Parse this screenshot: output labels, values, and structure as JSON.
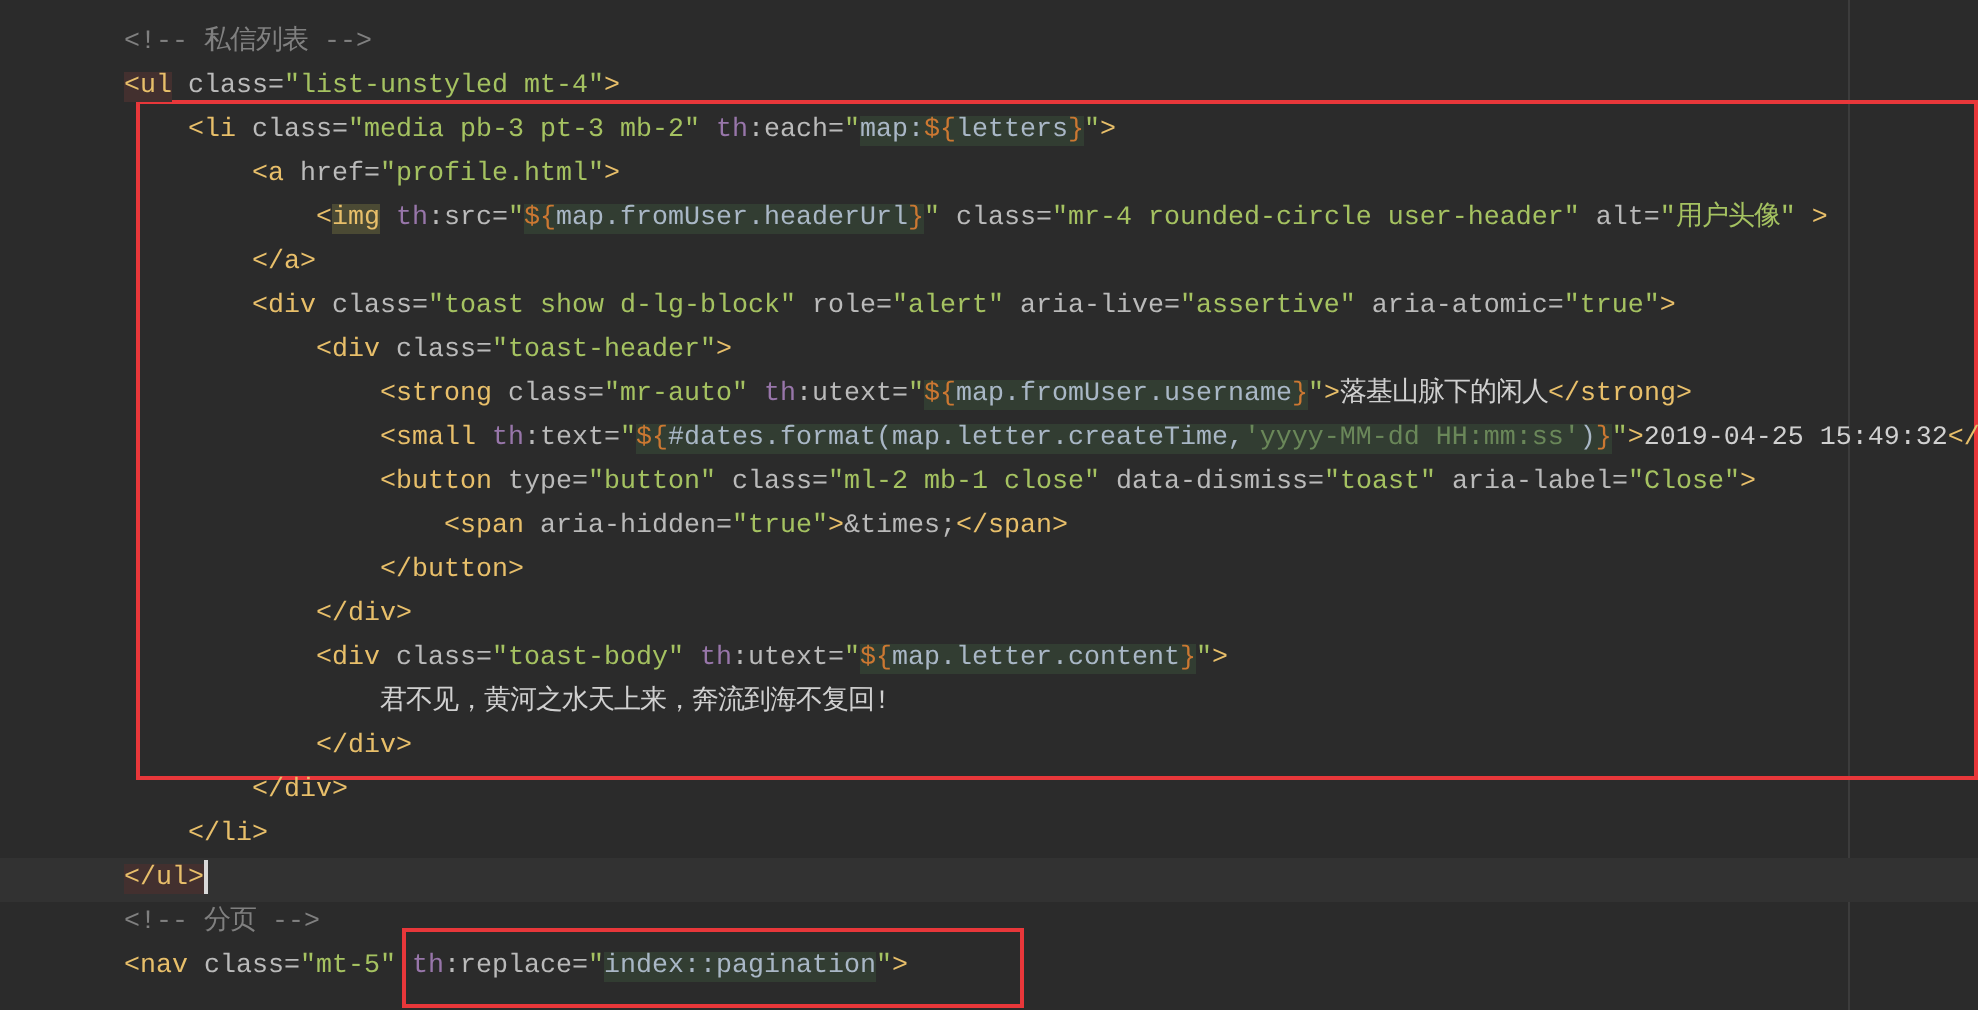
{
  "editor": {
    "lines": [
      {
        "framed": false,
        "current": false,
        "segments": [
          {
            "framed": false,
            "tokens": [
              {
                "kind": "comment",
                "text": "<!-- 私信列表 -->"
              }
            ]
          }
        ]
      },
      {
        "framed": false,
        "current": false,
        "segments": [
          {
            "framed": false,
            "tokens": [
              {
                "kind": "tag-match",
                "text": "<ul"
              },
              {
                "kind": "attr",
                "text": " class="
              },
              {
                "kind": "value",
                "text": "\"list-unstyled mt-4\""
              },
              {
                "kind": "tag",
                "text": ">"
              }
            ]
          }
        ],
        "children": [
          {
            "framed": true,
            "current": false,
            "segments": [
              {
                "framed": false,
                "tokens": [
                  {
                    "kind": "tag",
                    "text": "<li"
                  },
                  {
                    "kind": "attr",
                    "text": " class="
                  },
                  {
                    "kind": "value",
                    "text": "\"media pb-3 pt-3 mb-2\""
                  },
                  {
                    "kind": "ns",
                    "text": " th"
                  },
                  {
                    "kind": "attr",
                    "text": ":each="
                  },
                  {
                    "kind": "value",
                    "text": "\""
                  },
                  {
                    "kind": "expr",
                    "text": "map:"
                  },
                  {
                    "kind": "expr-delim",
                    "text": "${"
                  },
                  {
                    "kind": "expr",
                    "text": "letters"
                  },
                  {
                    "kind": "expr-delim",
                    "text": "}"
                  },
                  {
                    "kind": "value",
                    "text": "\""
                  },
                  {
                    "kind": "tag",
                    "text": ">"
                  }
                ]
              }
            ],
            "children": [
              {
                "framed": true,
                "current": false,
                "segments": [
                  {
                    "framed": false,
                    "tokens": [
                      {
                        "kind": "tag",
                        "text": "<a"
                      },
                      {
                        "kind": "attr",
                        "text": " href="
                      },
                      {
                        "kind": "value",
                        "text": "\"profile.html\""
                      },
                      {
                        "kind": "tag",
                        "text": ">"
                      }
                    ]
                  }
                ],
                "children": [
                  {
                    "framed": true,
                    "current": false,
                    "segments": [
                      {
                        "framed": false,
                        "tokens": [
                          {
                            "kind": "tag",
                            "text": "<"
                          },
                          {
                            "kind": "tag-hl",
                            "text": "img"
                          },
                          {
                            "kind": "ns",
                            "text": " th"
                          },
                          {
                            "kind": "attr",
                            "text": ":src="
                          },
                          {
                            "kind": "value",
                            "text": "\""
                          },
                          {
                            "kind": "expr-delim",
                            "text": "${"
                          },
                          {
                            "kind": "expr",
                            "text": "map.fromUser.headerUrl"
                          },
                          {
                            "kind": "expr-delim",
                            "text": "}"
                          },
                          {
                            "kind": "value",
                            "text": "\""
                          },
                          {
                            "kind": "attr",
                            "text": " class="
                          },
                          {
                            "kind": "value",
                            "text": "\"mr-4 rounded-circle user-header\""
                          },
                          {
                            "kind": "attr",
                            "text": " alt="
                          },
                          {
                            "kind": "value",
                            "text": "\"用户头像\""
                          },
                          {
                            "kind": "tag",
                            "text": " >"
                          }
                        ]
                      }
                    ]
                  }
                ]
              },
              {
                "framed": true,
                "current": false,
                "segments": [
                  {
                    "framed": false,
                    "tokens": [
                      {
                        "kind": "tag",
                        "text": "</a>"
                      }
                    ]
                  }
                ]
              },
              {
                "framed": true,
                "current": false,
                "segments": [
                  {
                    "framed": false,
                    "tokens": [
                      {
                        "kind": "tag",
                        "text": "<div"
                      },
                      {
                        "kind": "attr",
                        "text": " class="
                      },
                      {
                        "kind": "value",
                        "text": "\"toast show d-lg-block\""
                      },
                      {
                        "kind": "attr",
                        "text": " role="
                      },
                      {
                        "kind": "value",
                        "text": "\"alert\""
                      },
                      {
                        "kind": "attr",
                        "text": " aria-live="
                      },
                      {
                        "kind": "value",
                        "text": "\"assertive\""
                      },
                      {
                        "kind": "attr",
                        "text": " aria-atomic="
                      },
                      {
                        "kind": "value",
                        "text": "\"true\""
                      },
                      {
                        "kind": "tag",
                        "text": ">"
                      }
                    ]
                  }
                ],
                "children": [
                  {
                    "framed": true,
                    "current": false,
                    "segments": [
                      {
                        "framed": false,
                        "tokens": [
                          {
                            "kind": "tag",
                            "text": "<div"
                          },
                          {
                            "kind": "attr",
                            "text": " class="
                          },
                          {
                            "kind": "value",
                            "text": "\"toast-header\""
                          },
                          {
                            "kind": "tag",
                            "text": ">"
                          }
                        ]
                      }
                    ],
                    "children": [
                      {
                        "framed": true,
                        "current": false,
                        "segments": [
                          {
                            "framed": false,
                            "tokens": [
                              {
                                "kind": "tag",
                                "text": "<strong"
                              },
                              {
                                "kind": "attr",
                                "text": " class="
                              },
                              {
                                "kind": "value",
                                "text": "\"mr-auto\""
                              },
                              {
                                "kind": "ns",
                                "text": " th"
                              },
                              {
                                "kind": "attr",
                                "text": ":utext="
                              },
                              {
                                "kind": "value",
                                "text": "\""
                              },
                              {
                                "kind": "expr-delim",
                                "text": "${"
                              },
                              {
                                "kind": "expr",
                                "text": "map.fromUser.username"
                              },
                              {
                                "kind": "expr-delim",
                                "text": "}"
                              },
                              {
                                "kind": "value",
                                "text": "\""
                              },
                              {
                                "kind": "tag",
                                "text": ">"
                              },
                              {
                                "kind": "text",
                                "text": "落基山脉下的闲人"
                              },
                              {
                                "kind": "tag",
                                "text": "</strong>"
                              }
                            ]
                          }
                        ]
                      },
                      {
                        "framed": true,
                        "current": false,
                        "segments": [
                          {
                            "framed": false,
                            "tokens": [
                              {
                                "kind": "tag",
                                "text": "<small"
                              },
                              {
                                "kind": "ns",
                                "text": " th"
                              },
                              {
                                "kind": "attr",
                                "text": ":text="
                              },
                              {
                                "kind": "value",
                                "text": "\""
                              },
                              {
                                "kind": "expr-delim",
                                "text": "${"
                              },
                              {
                                "kind": "expr",
                                "text": "#dates.format(map.letter.createTime,"
                              },
                              {
                                "kind": "expr-str",
                                "text": "'yyyy-MM-dd HH:mm:ss'"
                              },
                              {
                                "kind": "expr",
                                "text": ")"
                              },
                              {
                                "kind": "expr-delim",
                                "text": "}"
                              },
                              {
                                "kind": "value",
                                "text": "\""
                              },
                              {
                                "kind": "tag",
                                "text": ">"
                              },
                              {
                                "kind": "text",
                                "text": "2019-04-25 15:49:32"
                              },
                              {
                                "kind": "tag",
                                "text": "</"
                              }
                            ]
                          }
                        ]
                      },
                      {
                        "framed": true,
                        "current": false,
                        "segments": [
                          {
                            "framed": false,
                            "tokens": [
                              {
                                "kind": "tag",
                                "text": "<button"
                              },
                              {
                                "kind": "attr",
                                "text": " type="
                              },
                              {
                                "kind": "value",
                                "text": "\"button\""
                              },
                              {
                                "kind": "attr",
                                "text": " class="
                              },
                              {
                                "kind": "value",
                                "text": "\"ml-2 mb-1 close\""
                              },
                              {
                                "kind": "attr",
                                "text": " data-dismiss="
                              },
                              {
                                "kind": "value",
                                "text": "\"toast\""
                              },
                              {
                                "kind": "attr",
                                "text": " aria-label="
                              },
                              {
                                "kind": "value",
                                "text": "\"Close\""
                              },
                              {
                                "kind": "tag",
                                "text": ">"
                              }
                            ]
                          }
                        ],
                        "children": [
                          {
                            "framed": true,
                            "current": false,
                            "segments": [
                              {
                                "framed": false,
                                "tokens": [
                                  {
                                    "kind": "tag",
                                    "text": "<span"
                                  },
                                  {
                                    "kind": "attr",
                                    "text": " aria-hidden="
                                  },
                                  {
                                    "kind": "value",
                                    "text": "\"true\""
                                  },
                                  {
                                    "kind": "tag",
                                    "text": ">"
                                  },
                                  {
                                    "kind": "attr",
                                    "text": "&times;"
                                  },
                                  {
                                    "kind": "tag",
                                    "text": "</span>"
                                  }
                                ]
                              }
                            ]
                          }
                        ]
                      },
                      {
                        "framed": true,
                        "current": false,
                        "segments": [
                          {
                            "framed": false,
                            "tokens": [
                              {
                                "kind": "tag",
                                "text": "</button>"
                              }
                            ]
                          }
                        ]
                      }
                    ]
                  },
                  {
                    "framed": true,
                    "current": false,
                    "segments": [
                      {
                        "framed": false,
                        "tokens": [
                          {
                            "kind": "tag",
                            "text": "</div>"
                          }
                        ]
                      }
                    ]
                  },
                  {
                    "framed": true,
                    "current": false,
                    "segments": [
                      {
                        "framed": false,
                        "tokens": [
                          {
                            "kind": "tag",
                            "text": "<div"
                          },
                          {
                            "kind": "attr",
                            "text": " class="
                          },
                          {
                            "kind": "value",
                            "text": "\"toast-body\""
                          },
                          {
                            "kind": "ns",
                            "text": " th"
                          },
                          {
                            "kind": "attr",
                            "text": ":utext="
                          },
                          {
                            "kind": "value",
                            "text": "\""
                          },
                          {
                            "kind": "expr-delim",
                            "text": "${"
                          },
                          {
                            "kind": "expr",
                            "text": "map.letter.content"
                          },
                          {
                            "kind": "expr-delim",
                            "text": "}"
                          },
                          {
                            "kind": "value",
                            "text": "\""
                          },
                          {
                            "kind": "tag",
                            "text": ">"
                          }
                        ]
                      }
                    ],
                    "children": [
                      {
                        "framed": true,
                        "current": false,
                        "segments": [
                          {
                            "framed": false,
                            "tokens": [
                              {
                                "kind": "text",
                                "text": "君不见，黄河之水天上来，奔流到海不复回!"
                              }
                            ]
                          }
                        ]
                      }
                    ]
                  },
                  {
                    "framed": true,
                    "current": false,
                    "segments": [
                      {
                        "framed": false,
                        "tokens": [
                          {
                            "kind": "tag",
                            "text": "</div>"
                          }
                        ]
                      }
                    ]
                  }
                ]
              },
              {
                "framed": false,
                "current": false,
                "segments": [
                  {
                    "framed": false,
                    "tokens": [
                      {
                        "kind": "tag",
                        "text": "</div>"
                      }
                    ]
                  }
                ]
              }
            ]
          },
          {
            "framed": false,
            "current": false,
            "segments": [
              {
                "framed": false,
                "tokens": [
                  {
                    "kind": "tag",
                    "text": "</li>"
                  }
                ]
              }
            ]
          }
        ]
      },
      {
        "framed": false,
        "current": true,
        "segments": [
          {
            "framed": false,
            "tokens": [
              {
                "kind": "tag-match",
                "text": "</ul>"
              }
            ]
          }
        ]
      },
      {
        "framed": false,
        "current": false,
        "segments": [
          {
            "framed": false,
            "tokens": [
              {
                "kind": "comment",
                "text": "<!-- 分页 -->"
              }
            ]
          }
        ]
      },
      {
        "framed": false,
        "current": false,
        "segments": [
          {
            "framed": false,
            "tokens": [
              {
                "kind": "tag",
                "text": "<nav"
              },
              {
                "kind": "attr",
                "text": " class="
              },
              {
                "kind": "value",
                "text": "\"mt-5\""
              }
            ]
          },
          {
            "framed": true,
            "tokens": [
              {
                "kind": "ns",
                "text": "th"
              },
              {
                "kind": "attr",
                "text": ":replace="
              },
              {
                "kind": "value",
                "text": "\""
              },
              {
                "kind": "expr",
                "text": "index::pagination"
              },
              {
                "kind": "value",
                "text": "\""
              },
              {
                "kind": "tag",
                "text": ">"
              }
            ]
          }
        ]
      }
    ]
  }
}
